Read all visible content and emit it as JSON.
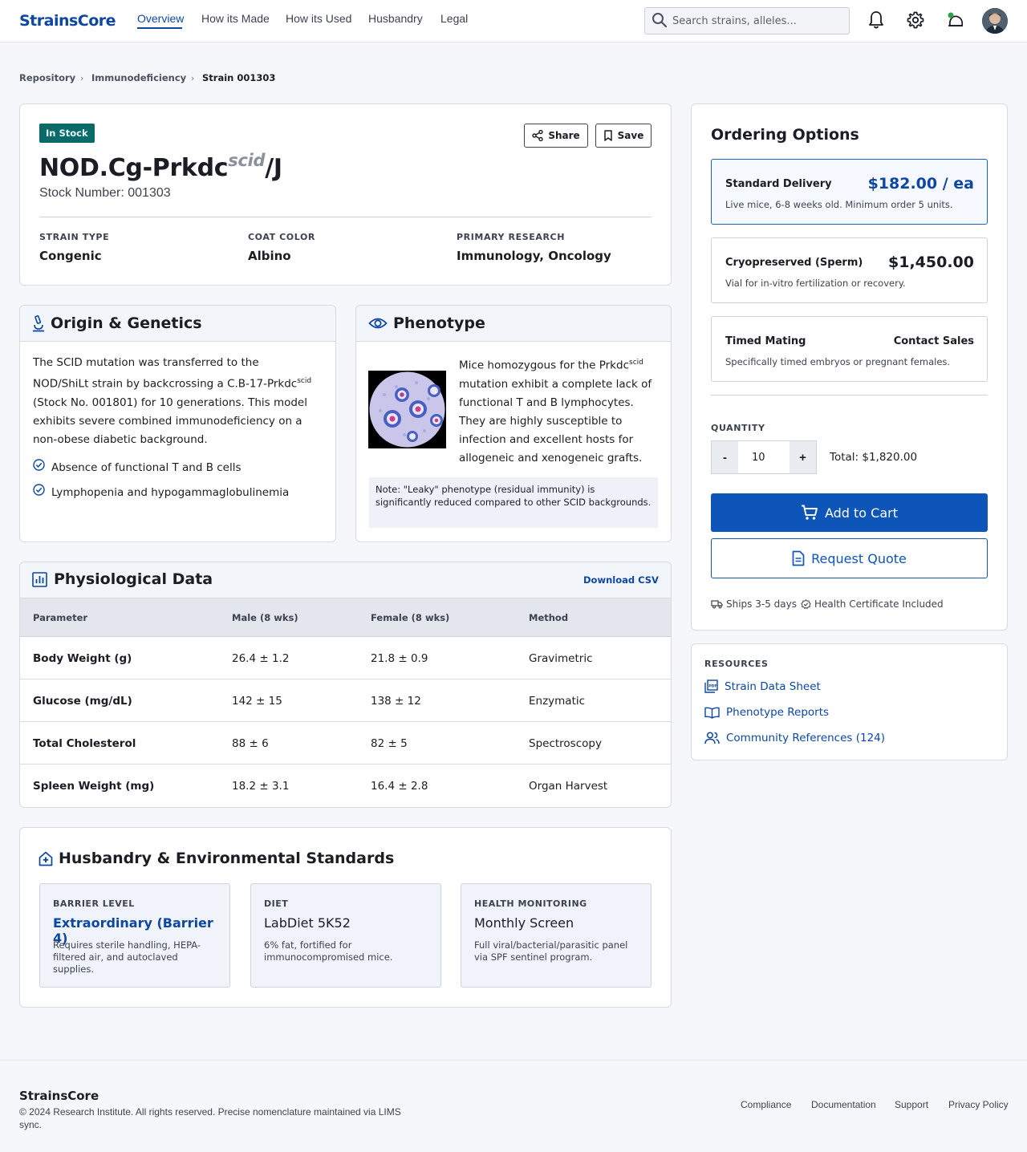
{
  "header": {
    "logo": "StrainsCore",
    "nav": [
      "Overview",
      "How its Made",
      "How its Used",
      "Husbandry",
      "Legal"
    ],
    "search_placeholder": "Search strains, alleles..."
  },
  "breadcrumb": [
    "Repository",
    "Immunodeficiency",
    "Strain 001303"
  ],
  "strain": {
    "status": "In Stock",
    "share_label": "Share",
    "save_label": "Save",
    "name_base": "NOD.Cg-Prkdc",
    "name_sup": "scid",
    "name_suffix": "/J",
    "stock_number": "Stock Number: 001303",
    "meta": [
      {
        "label": "STRAIN TYPE",
        "value": "Congenic"
      },
      {
        "label": "COAT COLOR",
        "value": "Albino"
      },
      {
        "label": "PRIMARY RESEARCH",
        "value": "Immunology, Oncology"
      }
    ]
  },
  "origin": {
    "title": "Origin & Genetics",
    "para_1": "The SCID mutation was transferred to the",
    "para_2a": "NOD/ShiLt strain by backcrossing a C.B-17-Prkdc",
    "para_2sup": "scid",
    "para_3": "(Stock No. 001801) for 10 generations. This model",
    "para_4": "exhibits severe combined immunodeficiency on a",
    "para_5": "non-obese diabetic background.",
    "checks": [
      "Absence of functional T and B cells",
      "Lymphopenia and hypogammaglobulinemia"
    ]
  },
  "phenotype": {
    "title": "Phenotype",
    "line_1a": "Mice homozygous for the Prkdc",
    "line_1sup": "scid",
    "line_2": "mutation exhibit a complete lack of",
    "line_3": "functional T and B lymphocytes.",
    "line_4": "They are highly susceptible to",
    "line_5": "infection and excellent hosts for",
    "line_6": "allogeneic and xenogeneic grafts.",
    "note": "Note: \"Leaky\" phenotype (residual immunity) is significantly reduced compared to other SCID backgrounds."
  },
  "physio": {
    "title": "Physiological Data",
    "download": "Download CSV",
    "columns": [
      "Parameter",
      "Male (8 wks)",
      "Female (8 wks)",
      "Method"
    ],
    "rows": [
      [
        "Body Weight (g)",
        "26.4 ± 1.2",
        "21.8 ± 0.9",
        "Gravimetric"
      ],
      [
        "Glucose (mg/dL)",
        "142 ± 15",
        "138 ± 12",
        "Enzymatic"
      ],
      [
        "Total Cholesterol",
        "88 ± 6",
        "82 ± 5",
        "Spectroscopy"
      ],
      [
        "Spleen Weight (mg)",
        "18.2 ± 3.1",
        "16.4 ± 2.8",
        "Organ Harvest"
      ]
    ]
  },
  "husbandry": {
    "title": "Husbandry & Environmental Standards",
    "cards": [
      {
        "label": "BARRIER LEVEL",
        "value": "Extraordinary (Barrier 4)",
        "desc": "Requires sterile handling, HEPA-filtered air, and autoclaved supplies."
      },
      {
        "label": "DIET",
        "value": "LabDiet 5K52",
        "desc": "6% fat, fortified for immunocompromised mice."
      },
      {
        "label": "HEALTH MONITORING",
        "value": "Monthly Screen",
        "desc": "Full viral/bacterial/parasitic panel via SPF sentinel program."
      }
    ]
  },
  "ordering": {
    "title": "Ordering Options",
    "options": [
      {
        "name": "Standard Delivery",
        "price": "$182.00 / ea",
        "desc": "Live mice, 6-8 weeks old. Minimum order 5 units."
      },
      {
        "name": "Cryopreserved (Sperm)",
        "price": "$1,450.00",
        "desc": "Vial for in-vitro fertilization or recovery."
      },
      {
        "name": "Timed Mating",
        "price": "Contact Sales",
        "desc": "Specifically timed embryos or pregnant females."
      }
    ],
    "quantity_label": "QUANTITY",
    "minus": "-",
    "plus": "+",
    "quantity": "10",
    "total": "Total: $1,820.00",
    "add_to_cart": "Add to Cart",
    "request_quote": "Request Quote",
    "ships": "Ships 3-5 days",
    "health_cert": "Health Certificate Included"
  },
  "resources": {
    "label": "RESOURCES",
    "links": [
      "Strain Data Sheet",
      "Phenotype Reports",
      "Community References (124)"
    ]
  },
  "footer": {
    "brand": "StrainsCore",
    "copyright": "© 2024 Research Institute. All rights reserved. Precise nomenclature maintained via LIMS sync.",
    "links": [
      "Compliance",
      "Documentation",
      "Support",
      "Privacy Policy"
    ]
  },
  "colors": {
    "brand": "#0d47a1",
    "accent_button": "#0d55b8",
    "stock_badge": "#0a6a6a"
  }
}
